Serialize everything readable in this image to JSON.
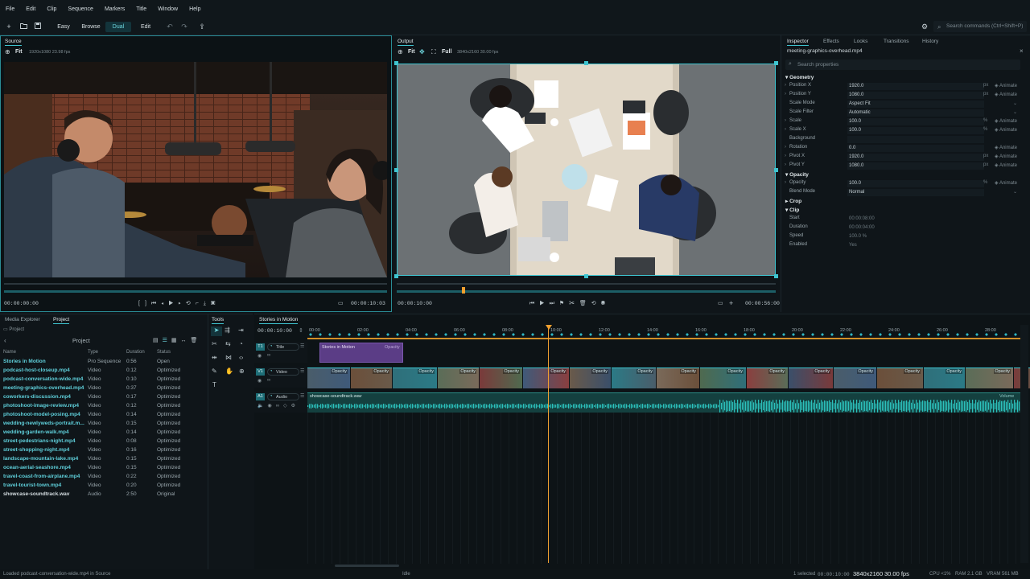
{
  "menu": [
    "File",
    "Edit",
    "Clip",
    "Sequence",
    "Markers",
    "Title",
    "Window",
    "Help"
  ],
  "toolbar": {
    "modes": [
      "Easy",
      "Browse",
      "Dual",
      "Edit"
    ],
    "active_mode": "Dual",
    "search_placeholder": "Search commands (Ctrl+Shift+P)"
  },
  "source": {
    "tab": "Source",
    "fit": "Fit",
    "info": "1920x1080 23.98 fps",
    "tc_left": "00:00:00:00",
    "tc_right": "00:00:10:03"
  },
  "output": {
    "tab": "Output",
    "fit": "Fit",
    "full": "Full",
    "info": "3840x2160 30.00 fps",
    "tc_left": "00:00:10:00",
    "tc_right": "00:00:56:00"
  },
  "inspector": {
    "tabs": [
      "Inspector",
      "Effects",
      "Looks",
      "Transitions",
      "History"
    ],
    "file": "meeting-graphics-overhead.mp4",
    "search_placeholder": "Search properties",
    "animate_label": "Animate",
    "sections": {
      "geometry": "Geometry",
      "opacity": "Opacity",
      "crop": "Crop",
      "clip": "Clip"
    },
    "geometry": [
      {
        "label": "Position X",
        "value": "1920.0",
        "unit": "px",
        "anim": true
      },
      {
        "label": "Position Y",
        "value": "1080.0",
        "unit": "px",
        "anim": true
      },
      {
        "label": "Scale Mode",
        "value": "Aspect Fit",
        "unit": "",
        "anim": false
      },
      {
        "label": "Scale Filter",
        "value": "Automatic",
        "unit": "",
        "anim": false
      },
      {
        "label": "Scale",
        "value": "100.0",
        "unit": "%",
        "anim": true
      },
      {
        "label": "Scale X",
        "value": "100.0",
        "unit": "%",
        "anim": true
      },
      {
        "label": "Background",
        "value": "",
        "unit": "",
        "anim": false
      },
      {
        "label": "Rotation",
        "value": "0.0",
        "unit": "",
        "anim": true
      },
      {
        "label": "Pivot X",
        "value": "1920.0",
        "unit": "px",
        "anim": true
      },
      {
        "label": "Pivot Y",
        "value": "1080.0",
        "unit": "px",
        "anim": true
      }
    ],
    "opacity": [
      {
        "label": "Opacity",
        "value": "100.0",
        "unit": "%",
        "anim": true
      },
      {
        "label": "Blend Mode",
        "value": "Normal",
        "unit": "",
        "anim": false
      }
    ],
    "clip": [
      {
        "label": "Start",
        "value": "00:00:08:00"
      },
      {
        "label": "Duration",
        "value": "00:00:04:00"
      },
      {
        "label": "Speed",
        "value": "100.0 %"
      },
      {
        "label": "Enabled",
        "value": "Yes"
      }
    ]
  },
  "project": {
    "tabs": [
      "Media Explorer",
      "Project"
    ],
    "breadcrumb": "Project",
    "title": "Project",
    "columns": [
      "Name",
      "Type",
      "Duration",
      "Status"
    ],
    "rows": [
      {
        "name": "Stories in Motion",
        "type": "Pro Sequence",
        "duration": "0:56",
        "status": "Open"
      },
      {
        "name": "podcast-host-closeup.mp4",
        "type": "Video",
        "duration": "0:12",
        "status": "Optimized"
      },
      {
        "name": "podcast-conversation-wide.mp4",
        "type": "Video",
        "duration": "0:10",
        "status": "Optimized"
      },
      {
        "name": "meeting-graphics-overhead.mp4",
        "type": "Video",
        "duration": "0:37",
        "status": "Optimized"
      },
      {
        "name": "coworkers-discussion.mp4",
        "type": "Video",
        "duration": "0:17",
        "status": "Optimized"
      },
      {
        "name": "photoshoot-image-review.mp4",
        "type": "Video",
        "duration": "0:12",
        "status": "Optimized"
      },
      {
        "name": "photoshoot-model-posing.mp4",
        "type": "Video",
        "duration": "0:14",
        "status": "Optimized"
      },
      {
        "name": "wedding-newlyweds-portrait.m...",
        "type": "Video",
        "duration": "0:15",
        "status": "Optimized"
      },
      {
        "name": "wedding-garden-walk.mp4",
        "type": "Video",
        "duration": "0:14",
        "status": "Optimized"
      },
      {
        "name": "street-pedestrians-night.mp4",
        "type": "Video",
        "duration": "0:08",
        "status": "Optimized"
      },
      {
        "name": "street-shopping-night.mp4",
        "type": "Video",
        "duration": "0:16",
        "status": "Optimized"
      },
      {
        "name": "landscape-mountain-lake.mp4",
        "type": "Video",
        "duration": "0:15",
        "status": "Optimized"
      },
      {
        "name": "ocean-aerial-seashore.mp4",
        "type": "Video",
        "duration": "0:15",
        "status": "Optimized"
      },
      {
        "name": "travel-coast-from-airplane.mp4",
        "type": "Video",
        "duration": "0:22",
        "status": "Optimized"
      },
      {
        "name": "travel-tourist-town.mp4",
        "type": "Video",
        "duration": "0:20",
        "status": "Optimized"
      },
      {
        "name": "showcase-soundtrack.wav",
        "type": "Audio",
        "duration": "2:50",
        "status": "Original"
      }
    ]
  },
  "tools": {
    "tab": "Tools"
  },
  "timeline": {
    "tab": "Stories in Motion",
    "timecode": "00:00:10:00",
    "ruler": [
      "00:00",
      "02:00",
      "04:00",
      "06:00",
      "08:00",
      "10:00",
      "12:00",
      "14:00",
      "16:00",
      "18:00",
      "20:00",
      "22:00",
      "24:00",
      "26:00",
      "28:00"
    ],
    "tracks": {
      "title": {
        "id": "T1",
        "name": "Title",
        "clip": "Stories in Motion",
        "effect": "Opacity"
      },
      "video": {
        "id": "V1",
        "name": "Video",
        "effect": "Opacity"
      },
      "audio": {
        "id": "A1",
        "name": "Audio",
        "clip": "showcase-soundtrack.wav",
        "effect": "Volume"
      }
    }
  },
  "status": {
    "message": "Loaded podcast-conversation-wide.mp4 in Source",
    "idle": "Idle",
    "selected": "1 selected",
    "tc": "00:00:10:00",
    "resolution": "3840x2160",
    "fps": "30.00 fps",
    "cpu": "CPU <1%",
    "ram": "RAM 2.1 GB",
    "vram": "VRAM 561 MB"
  },
  "colors": {
    "accent": "#3ec4cf",
    "playhead": "#f0a030",
    "title_clip": "#5b3d86",
    "audio_clip": "#1f6f6b"
  }
}
